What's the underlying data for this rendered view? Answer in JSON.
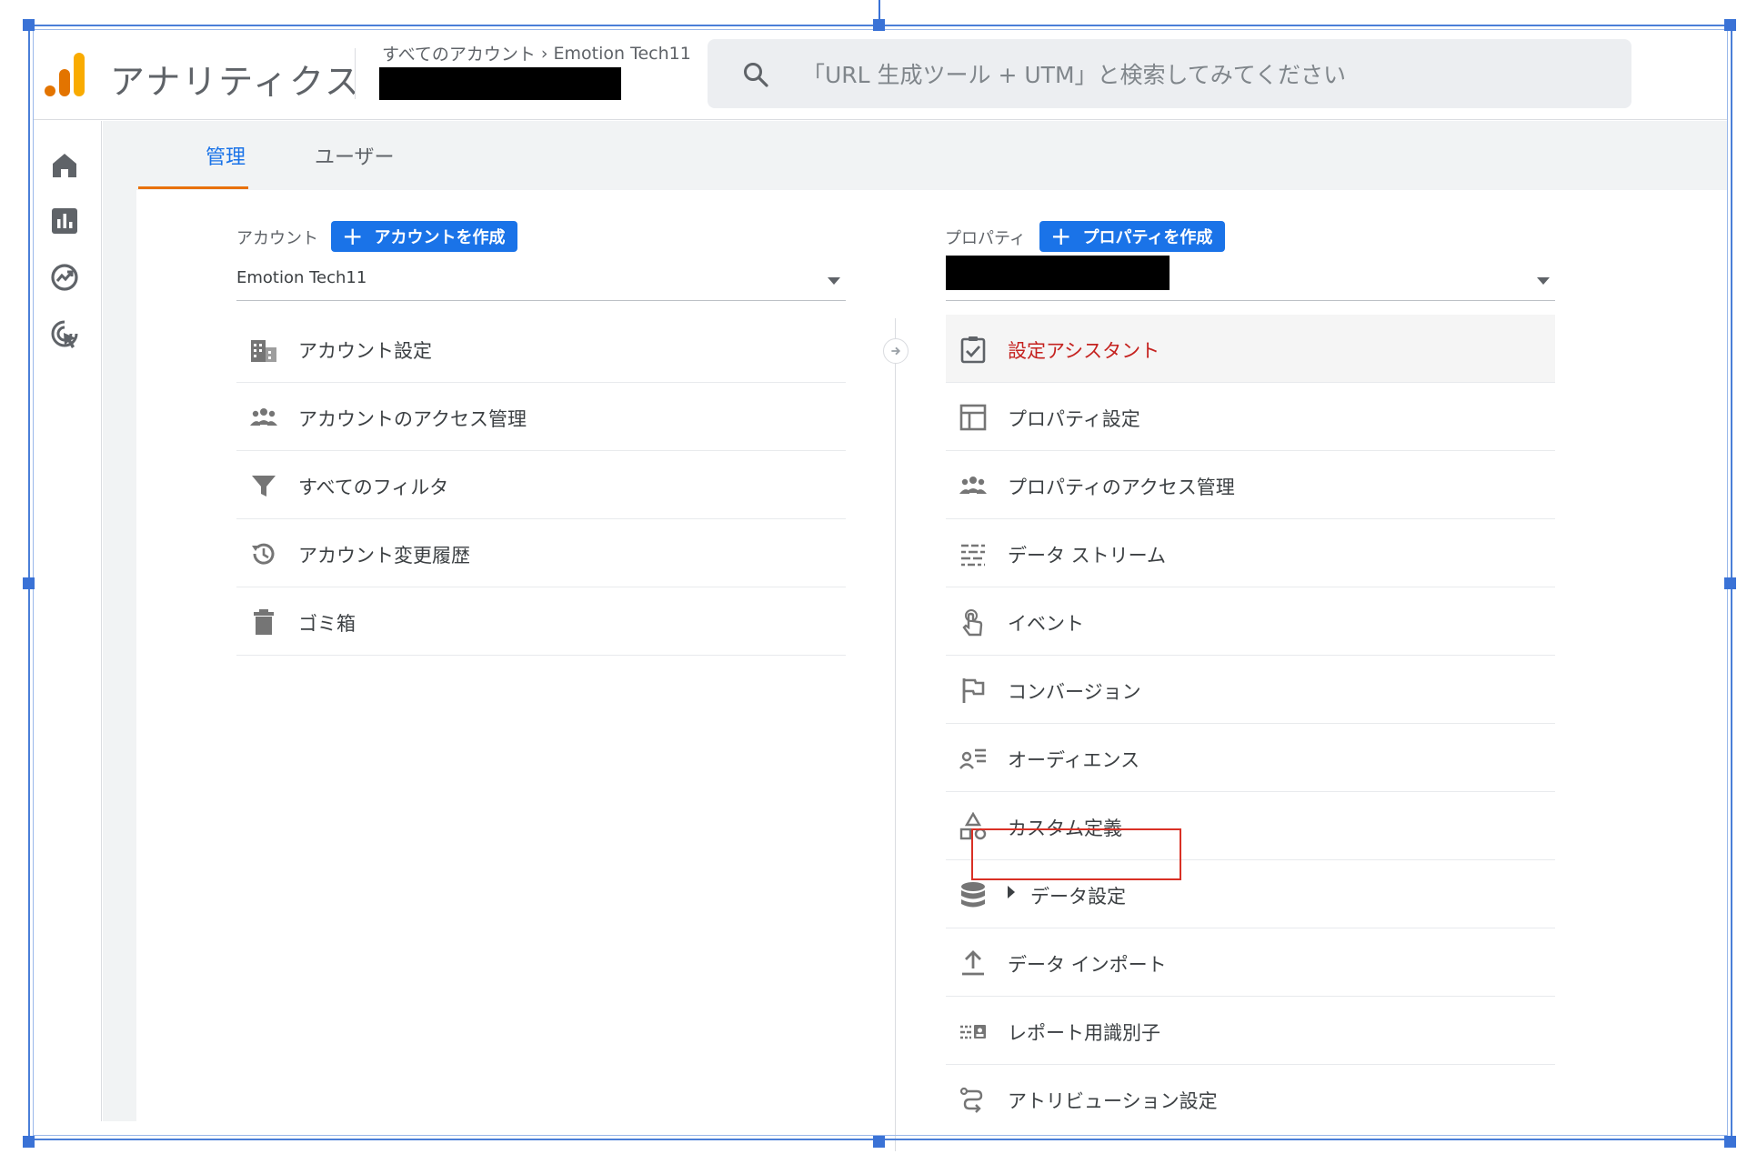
{
  "header": {
    "product_name": "アナリティクス",
    "breadcrumb_all": "すべてのアカウント",
    "breadcrumb_account": "Emotion Tech11",
    "search_placeholder": "「URL 生成ツール + UTM」と検索してみてください"
  },
  "rail": {
    "icons": [
      "home-icon",
      "reports-icon",
      "explore-icon",
      "advertising-icon"
    ]
  },
  "tabs": [
    {
      "label": "管理",
      "active": true
    },
    {
      "label": "ユーザー",
      "active": false
    }
  ],
  "account": {
    "label": "アカウント",
    "create_button": "アカウントを作成",
    "selected": "Emotion Tech11",
    "items": [
      {
        "label": "アカウント設定",
        "icon": "building-icon"
      },
      {
        "label": "アカウントのアクセス管理",
        "icon": "people-icon"
      },
      {
        "label": "すべてのフィルタ",
        "icon": "filter-icon"
      },
      {
        "label": "アカウント変更履歴",
        "icon": "history-icon"
      },
      {
        "label": "ゴミ箱",
        "icon": "trash-icon"
      }
    ]
  },
  "property": {
    "label": "プロパティ",
    "create_button": "プロパティを作成",
    "items": [
      {
        "label": "設定アシスタント",
        "icon": "checklist-icon",
        "active": true
      },
      {
        "label": "プロパティ設定",
        "icon": "layout-icon"
      },
      {
        "label": "プロパティのアクセス管理",
        "icon": "people-icon"
      },
      {
        "label": "データ ストリーム",
        "icon": "streams-icon"
      },
      {
        "label": "イベント",
        "icon": "touch-icon"
      },
      {
        "label": "コンバージョン",
        "icon": "flag-icon"
      },
      {
        "label": "オーディエンス",
        "icon": "audience-icon"
      },
      {
        "label": "カスタム定義",
        "icon": "shapes-icon"
      },
      {
        "label": "データ設定",
        "icon": "database-icon",
        "expandable": true
      },
      {
        "label": "データ インポート",
        "icon": "upload-icon"
      },
      {
        "label": "レポート用識別子",
        "icon": "identity-icon"
      },
      {
        "label": "アトリビューション設定",
        "icon": "attribution-icon"
      }
    ]
  },
  "colors": {
    "accent": "#1a73e8",
    "tab_underline": "#e8710a",
    "active_item_text": "#c5221f",
    "highlight_border": "#d93025"
  }
}
